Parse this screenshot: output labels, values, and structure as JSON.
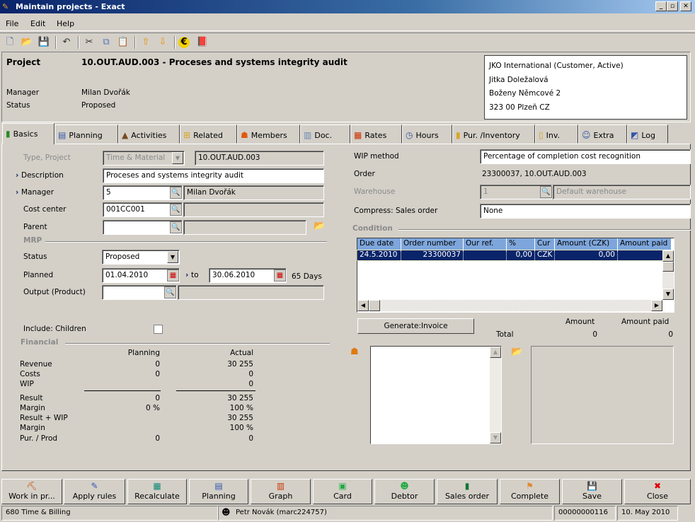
{
  "window": {
    "title": "Maintain projects - Exact",
    "min": "_",
    "max": "▫",
    "close": "✕"
  },
  "menu": [
    "File",
    "Edit",
    "Help"
  ],
  "toolbar": [
    {
      "icon": "new-icon",
      "g": "🗋",
      "c": "#3355aa"
    },
    {
      "icon": "open-icon",
      "g": "📂",
      "c": "#d9a520"
    },
    {
      "icon": "save-icon",
      "g": "💾",
      "c": "#555"
    },
    {
      "sep": true
    },
    {
      "icon": "undo-icon",
      "g": "↶",
      "c": "#333"
    },
    {
      "sep": true
    },
    {
      "icon": "cut-icon",
      "g": "✂",
      "c": "#333"
    },
    {
      "icon": "copy-icon",
      "g": "⧉",
      "c": "#5577bb"
    },
    {
      "icon": "paste-icon",
      "g": "📋",
      "c": "#c9a040"
    },
    {
      "sep": true
    },
    {
      "icon": "arrow-up-icon",
      "g": "⇧",
      "c": "#f08c00"
    },
    {
      "icon": "arrow-down-icon",
      "g": "⇩",
      "c": "#f08c00"
    },
    {
      "sep": true
    },
    {
      "icon": "euro-icon",
      "g": "€",
      "c": "#000",
      "bg": "#f5d000"
    },
    {
      "icon": "book-icon",
      "g": "📕",
      "c": "#7a3d9a"
    }
  ],
  "header": {
    "project_label": "Project",
    "project_value": "10.OUT.AUD.003 - Proceses and systems integrity audit",
    "manager_label": "Manager",
    "manager_value": "Milan Dvořák",
    "status_label": "Status",
    "status_value": "Proposed",
    "customer": [
      "JKO International (Customer, Active)",
      "",
      "Jitka Doležalová",
      "Boženy Němcové 2",
      "323 00 Plzeň CZ"
    ]
  },
  "tabs": [
    {
      "label": "Basics",
      "icon": "basics-icon",
      "g": "▮",
      "c": "#2a8a2a"
    },
    {
      "label": "Planning",
      "icon": "planning-icon",
      "g": "▤",
      "c": "#3355aa"
    },
    {
      "label": "Activities",
      "icon": "activities-icon",
      "g": "▲",
      "c": "#7a4a20"
    },
    {
      "label": "Related",
      "icon": "related-icon",
      "g": "⊞",
      "c": "#d9a520"
    },
    {
      "label": "Members",
      "icon": "members-icon",
      "g": "☗",
      "c": "#e05a10"
    },
    {
      "label": "Doc.",
      "icon": "documents-icon",
      "g": "▥",
      "c": "#6a8ab0"
    },
    {
      "label": "Rates",
      "icon": "rates-icon",
      "g": "▦",
      "c": "#cc3300"
    },
    {
      "label": "Hours",
      "icon": "clock-icon",
      "g": "◷",
      "c": "#335599"
    },
    {
      "label": "Pur. /Inventory",
      "icon": "inventory-icon",
      "g": "▮",
      "c": "#d9a520"
    },
    {
      "label": "Inv.",
      "icon": "invoice-icon",
      "g": "▯",
      "c": "#d9a520"
    },
    {
      "label": "Extra",
      "icon": "extra-icon",
      "g": "☺",
      "c": "#335599"
    },
    {
      "label": "Log",
      "icon": "log-icon",
      "g": "◩",
      "c": "#3355aa"
    }
  ],
  "basics": {
    "type_label": "Type, Project",
    "type_value": "Time & Material",
    "project_code": "10.OUT.AUD.003",
    "description_label": "Description",
    "description_value": "Proceses and systems integrity audit",
    "manager_label": "Manager",
    "manager_code": "5",
    "manager_name": "Milan Dvořák",
    "cost_center_label": "Cost center",
    "cost_center_value": "001CC001",
    "parent_label": "Parent",
    "parent_value": "",
    "mrp_label": "MRP",
    "status_label": "Status",
    "status_value": "Proposed",
    "planned_label": "Planned",
    "planned_from": "01.04.2010",
    "to_label": "to",
    "planned_to": "30.06.2010",
    "days": "65 Days",
    "output_label": "Output (Product)",
    "output_value": "",
    "include_children_label": "Include: Children",
    "include_children": false,
    "financial_label": "Financial",
    "planning_col": "Planning",
    "actual_col": "Actual",
    "financial_rows": [
      [
        "Revenue",
        "0",
        "30 255"
      ],
      [
        "Costs",
        "0",
        "0"
      ],
      [
        "WIP",
        "",
        "0"
      ],
      [
        "Result",
        "0",
        "30 255"
      ],
      [
        "Margin",
        "0 %",
        "100 %"
      ],
      [
        "Result + WIP",
        "",
        "30 255"
      ],
      [
        "Margin",
        "",
        "100 %"
      ],
      [
        "Pur. / Prod",
        "0",
        "0"
      ]
    ],
    "wip_label": "WIP method",
    "wip_value": "Percentage of completion cost recognition",
    "order_label": "Order",
    "order_value": "23300037, 10.OUT.AUD.003",
    "warehouse_label": "Warehouse",
    "warehouse_code": "1",
    "warehouse_name": "Default warehouse",
    "compress_label": "Compress: Sales order",
    "compress_value": "None",
    "condition_label": "Condition",
    "grid_headers": [
      "Due date",
      "Order number",
      "Our ref.",
      "%",
      "Cur",
      "Amount (CZK)",
      "Amount paid"
    ],
    "grid_rows": [
      [
        "24.5.2010",
        "23300037",
        "",
        "0,00",
        "CZK",
        "0,00",
        ""
      ]
    ],
    "generate_invoice": "Generate:Invoice",
    "amount_label": "Amount",
    "amount_paid_label": "Amount paid",
    "total_label": "Total",
    "total_amount": "0",
    "total_paid": "0"
  },
  "buttons": [
    {
      "label": "Work in pr...",
      "icon": "work-in-progress-icon",
      "g": "⛏",
      "c": "#c05010"
    },
    {
      "label": "Apply rules",
      "icon": "apply-rules-icon",
      "g": "✎",
      "c": "#3355aa"
    },
    {
      "label": "Recalculate",
      "icon": "calculator-icon",
      "g": "▦",
      "c": "#118877"
    },
    {
      "label": "Planning",
      "icon": "planning-icon",
      "g": "▤",
      "c": "#3355aa"
    },
    {
      "label": "Graph",
      "icon": "graph-icon",
      "g": "▥",
      "c": "#cc3300"
    },
    {
      "label": "Card",
      "icon": "card-icon",
      "g": "▣",
      "c": "#22aa44"
    },
    {
      "label": "Debtor",
      "icon": "debtor-icon",
      "g": "☻",
      "c": "#22aa44"
    },
    {
      "label": "Sales order",
      "icon": "sales-order-icon",
      "g": "▮",
      "c": "#117733"
    },
    {
      "label": "Complete",
      "icon": "flag-icon",
      "g": "⚑",
      "c": "#e08a30"
    },
    {
      "label": "Save",
      "icon": "save-icon",
      "g": "💾",
      "c": "#555"
    },
    {
      "label": "Close",
      "icon": "close-icon",
      "g": "✖",
      "c": "#dd0000"
    }
  ],
  "status": {
    "company": "680 Time & Billing",
    "user": "Petr Novák (marc224757)",
    "number": "00000000116",
    "date": "10. May 2010"
  }
}
